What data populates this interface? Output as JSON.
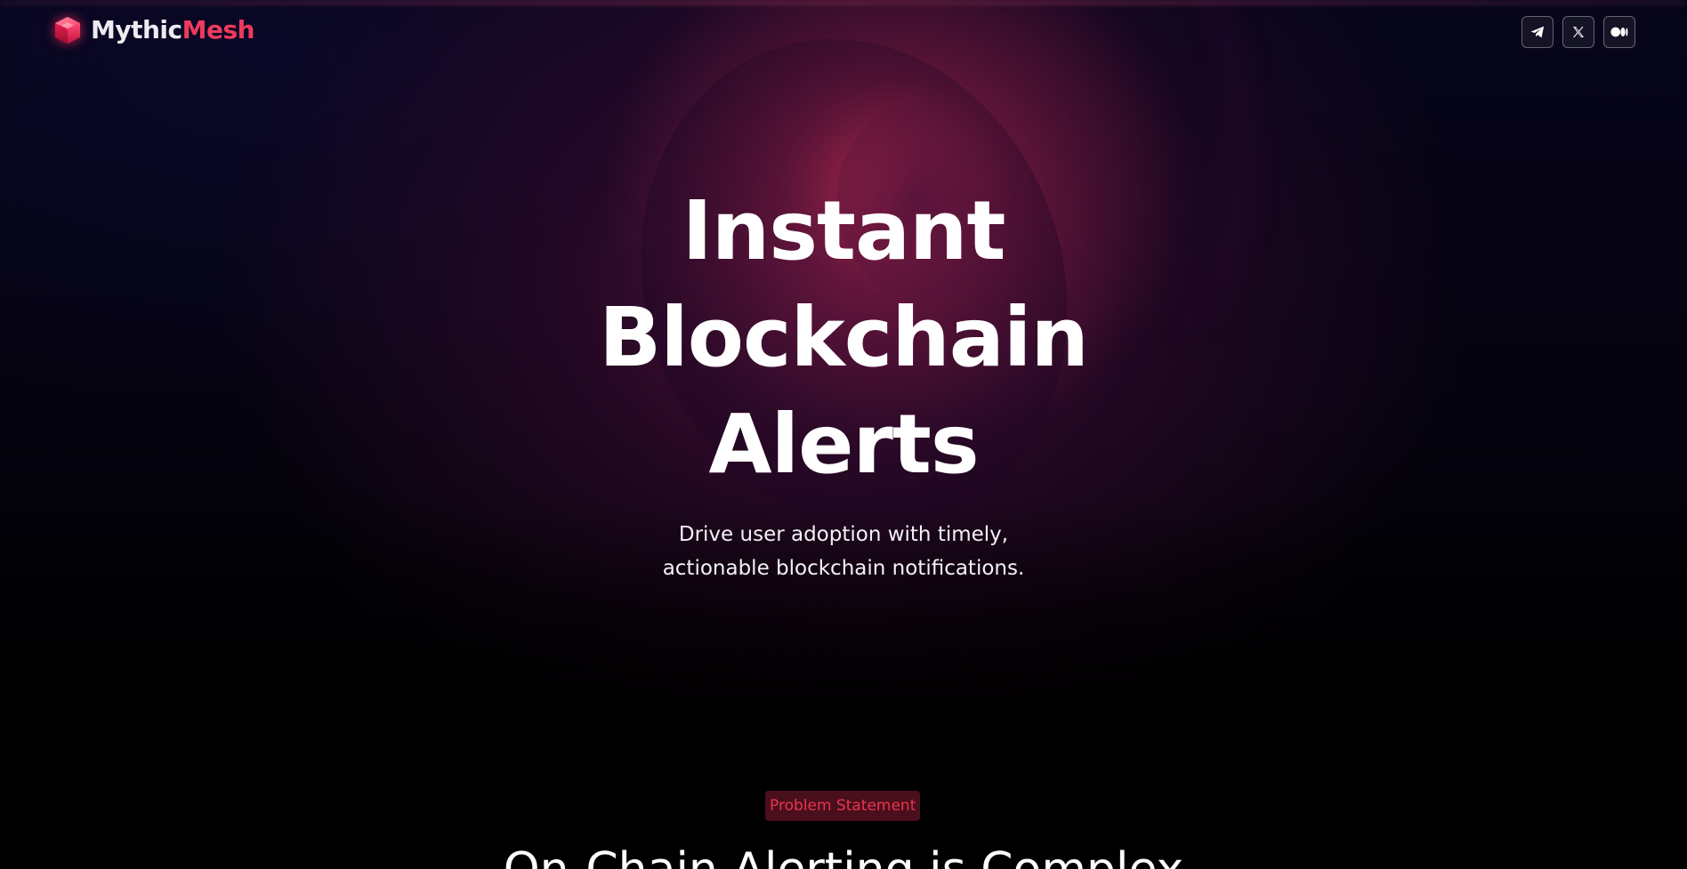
{
  "header": {
    "logo": {
      "icon": "cube-icon",
      "name_part_1": "Mythic",
      "name_part_2": "Mesh"
    },
    "socials": [
      {
        "icon": "telegram-icon"
      },
      {
        "icon": "x-icon"
      },
      {
        "icon": "medium-icon"
      }
    ]
  },
  "hero": {
    "title_lines": [
      "Instant",
      "Blockchain",
      "Alerts"
    ],
    "subtitle_lines": [
      "Drive user adoption with timely,",
      "actionable blockchain notifications."
    ]
  },
  "problem": {
    "badge": "Problem Statement",
    "title": "On-Chain Alerting is Complex"
  },
  "colors": {
    "brand_accent": "#ef3a5d",
    "badge_bg": "#4a0f1c",
    "badge_text": "#e8344f",
    "background": "#000000"
  }
}
